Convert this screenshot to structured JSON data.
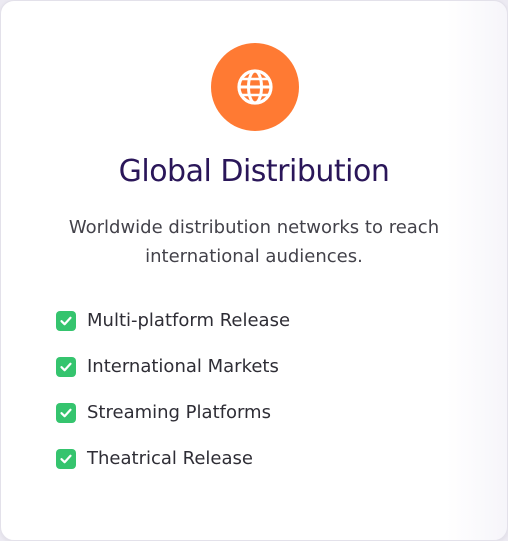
{
  "card": {
    "icon": "globe-icon",
    "icon_bg_color": "#ff7a33",
    "title": "Global Distribution",
    "description": "Worldwide distribution networks to reach international audiences.",
    "features": [
      {
        "label": "Multi-platform Release",
        "icon": "check-icon"
      },
      {
        "label": "International Markets",
        "icon": "check-icon"
      },
      {
        "label": "Streaming Platforms",
        "icon": "check-icon"
      },
      {
        "label": "Theatrical Release",
        "icon": "check-icon"
      }
    ],
    "check_color": "#35c46e",
    "title_color": "#2a1659"
  }
}
